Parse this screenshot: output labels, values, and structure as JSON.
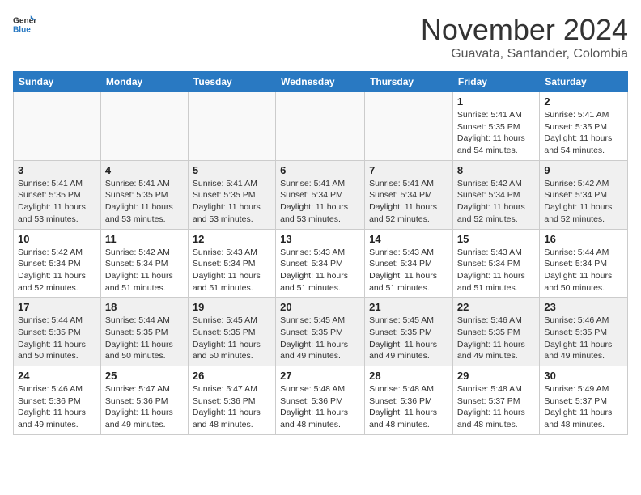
{
  "header": {
    "logo_general": "General",
    "logo_blue": "Blue",
    "month_title": "November 2024",
    "location": "Guavata, Santander, Colombia"
  },
  "weekdays": [
    "Sunday",
    "Monday",
    "Tuesday",
    "Wednesday",
    "Thursday",
    "Friday",
    "Saturday"
  ],
  "weeks": [
    [
      {
        "day": "",
        "info": ""
      },
      {
        "day": "",
        "info": ""
      },
      {
        "day": "",
        "info": ""
      },
      {
        "day": "",
        "info": ""
      },
      {
        "day": "",
        "info": ""
      },
      {
        "day": "1",
        "info": "Sunrise: 5:41 AM\nSunset: 5:35 PM\nDaylight: 11 hours\nand 54 minutes."
      },
      {
        "day": "2",
        "info": "Sunrise: 5:41 AM\nSunset: 5:35 PM\nDaylight: 11 hours\nand 54 minutes."
      }
    ],
    [
      {
        "day": "3",
        "info": "Sunrise: 5:41 AM\nSunset: 5:35 PM\nDaylight: 11 hours\nand 53 minutes."
      },
      {
        "day": "4",
        "info": "Sunrise: 5:41 AM\nSunset: 5:35 PM\nDaylight: 11 hours\nand 53 minutes."
      },
      {
        "day": "5",
        "info": "Sunrise: 5:41 AM\nSunset: 5:35 PM\nDaylight: 11 hours\nand 53 minutes."
      },
      {
        "day": "6",
        "info": "Sunrise: 5:41 AM\nSunset: 5:34 PM\nDaylight: 11 hours\nand 53 minutes."
      },
      {
        "day": "7",
        "info": "Sunrise: 5:41 AM\nSunset: 5:34 PM\nDaylight: 11 hours\nand 52 minutes."
      },
      {
        "day": "8",
        "info": "Sunrise: 5:42 AM\nSunset: 5:34 PM\nDaylight: 11 hours\nand 52 minutes."
      },
      {
        "day": "9",
        "info": "Sunrise: 5:42 AM\nSunset: 5:34 PM\nDaylight: 11 hours\nand 52 minutes."
      }
    ],
    [
      {
        "day": "10",
        "info": "Sunrise: 5:42 AM\nSunset: 5:34 PM\nDaylight: 11 hours\nand 52 minutes."
      },
      {
        "day": "11",
        "info": "Sunrise: 5:42 AM\nSunset: 5:34 PM\nDaylight: 11 hours\nand 51 minutes."
      },
      {
        "day": "12",
        "info": "Sunrise: 5:43 AM\nSunset: 5:34 PM\nDaylight: 11 hours\nand 51 minutes."
      },
      {
        "day": "13",
        "info": "Sunrise: 5:43 AM\nSunset: 5:34 PM\nDaylight: 11 hours\nand 51 minutes."
      },
      {
        "day": "14",
        "info": "Sunrise: 5:43 AM\nSunset: 5:34 PM\nDaylight: 11 hours\nand 51 minutes."
      },
      {
        "day": "15",
        "info": "Sunrise: 5:43 AM\nSunset: 5:34 PM\nDaylight: 11 hours\nand 51 minutes."
      },
      {
        "day": "16",
        "info": "Sunrise: 5:44 AM\nSunset: 5:34 PM\nDaylight: 11 hours\nand 50 minutes."
      }
    ],
    [
      {
        "day": "17",
        "info": "Sunrise: 5:44 AM\nSunset: 5:35 PM\nDaylight: 11 hours\nand 50 minutes."
      },
      {
        "day": "18",
        "info": "Sunrise: 5:44 AM\nSunset: 5:35 PM\nDaylight: 11 hours\nand 50 minutes."
      },
      {
        "day": "19",
        "info": "Sunrise: 5:45 AM\nSunset: 5:35 PM\nDaylight: 11 hours\nand 50 minutes."
      },
      {
        "day": "20",
        "info": "Sunrise: 5:45 AM\nSunset: 5:35 PM\nDaylight: 11 hours\nand 49 minutes."
      },
      {
        "day": "21",
        "info": "Sunrise: 5:45 AM\nSunset: 5:35 PM\nDaylight: 11 hours\nand 49 minutes."
      },
      {
        "day": "22",
        "info": "Sunrise: 5:46 AM\nSunset: 5:35 PM\nDaylight: 11 hours\nand 49 minutes."
      },
      {
        "day": "23",
        "info": "Sunrise: 5:46 AM\nSunset: 5:35 PM\nDaylight: 11 hours\nand 49 minutes."
      }
    ],
    [
      {
        "day": "24",
        "info": "Sunrise: 5:46 AM\nSunset: 5:36 PM\nDaylight: 11 hours\nand 49 minutes."
      },
      {
        "day": "25",
        "info": "Sunrise: 5:47 AM\nSunset: 5:36 PM\nDaylight: 11 hours\nand 49 minutes."
      },
      {
        "day": "26",
        "info": "Sunrise: 5:47 AM\nSunset: 5:36 PM\nDaylight: 11 hours\nand 48 minutes."
      },
      {
        "day": "27",
        "info": "Sunrise: 5:48 AM\nSunset: 5:36 PM\nDaylight: 11 hours\nand 48 minutes."
      },
      {
        "day": "28",
        "info": "Sunrise: 5:48 AM\nSunset: 5:36 PM\nDaylight: 11 hours\nand 48 minutes."
      },
      {
        "day": "29",
        "info": "Sunrise: 5:48 AM\nSunset: 5:37 PM\nDaylight: 11 hours\nand 48 minutes."
      },
      {
        "day": "30",
        "info": "Sunrise: 5:49 AM\nSunset: 5:37 PM\nDaylight: 11 hours\nand 48 minutes."
      }
    ]
  ]
}
